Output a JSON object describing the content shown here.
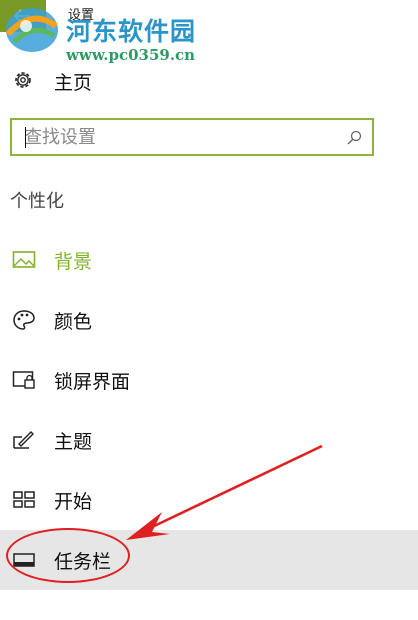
{
  "window": {
    "title": "设置"
  },
  "watermark": {
    "site_name": "河东软件园",
    "url": "www.pc0359.cn"
  },
  "home": {
    "label": "主页",
    "icon": "gear-icon"
  },
  "search": {
    "placeholder": "查找设置",
    "value": ""
  },
  "section": {
    "title": "个性化"
  },
  "nav": {
    "items": [
      {
        "label": "背景",
        "icon": "picture-icon",
        "state": "active"
      },
      {
        "label": "颜色",
        "icon": "palette-icon",
        "state": "normal"
      },
      {
        "label": "锁屏界面",
        "icon": "lock-screen-icon",
        "state": "normal"
      },
      {
        "label": "主题",
        "icon": "theme-brush-icon",
        "state": "normal"
      },
      {
        "label": "开始",
        "icon": "start-tiles-icon",
        "state": "normal"
      },
      {
        "label": "任务栏",
        "icon": "taskbar-icon",
        "state": "hover"
      }
    ]
  },
  "colors": {
    "accent": "#7fb32a",
    "back_button": "#7a9a28",
    "hover_bg": "#e6e6e6",
    "annotation": "#e02020"
  }
}
